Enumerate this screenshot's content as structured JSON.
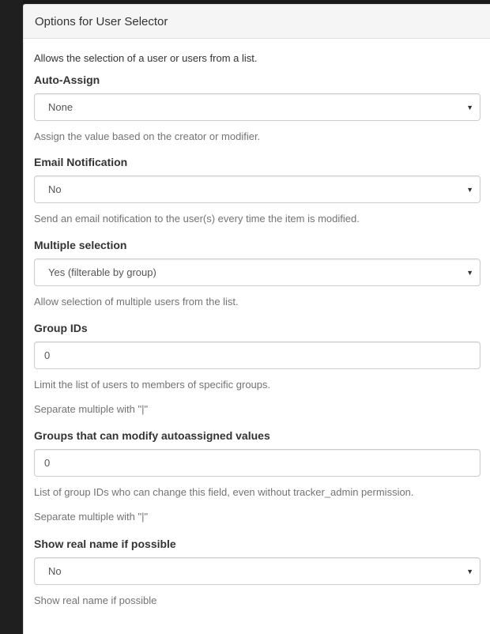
{
  "panel": {
    "title": "Options for User Selector",
    "intro": "Allows the selection of a user or users from a list."
  },
  "fields": {
    "auto_assign": {
      "label": "Auto-Assign",
      "value": "None",
      "help": "Assign the value based on the creator or modifier."
    },
    "email_notification": {
      "label": "Email Notification",
      "value": "No",
      "help": "Send an email notification to the user(s) every time the item is modified."
    },
    "multiple_selection": {
      "label": "Multiple selection",
      "value": "Yes (filterable by group)",
      "help": "Allow selection of multiple users from the list."
    },
    "group_ids": {
      "label": "Group IDs",
      "value": "0",
      "help": "Limit the list of users to members of specific groups.",
      "help2": "Separate multiple with \"|\""
    },
    "modify_groups": {
      "label": "Groups that can modify autoassigned values",
      "value": "0",
      "help": "List of group IDs who can change this field, even without tracker_admin permission.",
      "help2": "Separate multiple with \"|\""
    },
    "show_real_name": {
      "label": "Show real name if possible",
      "value": "No",
      "help": "Show real name if possible"
    }
  },
  "icons": {
    "dropdown": "caret-down-icon"
  },
  "glyphs": {
    "caret": "▼"
  }
}
